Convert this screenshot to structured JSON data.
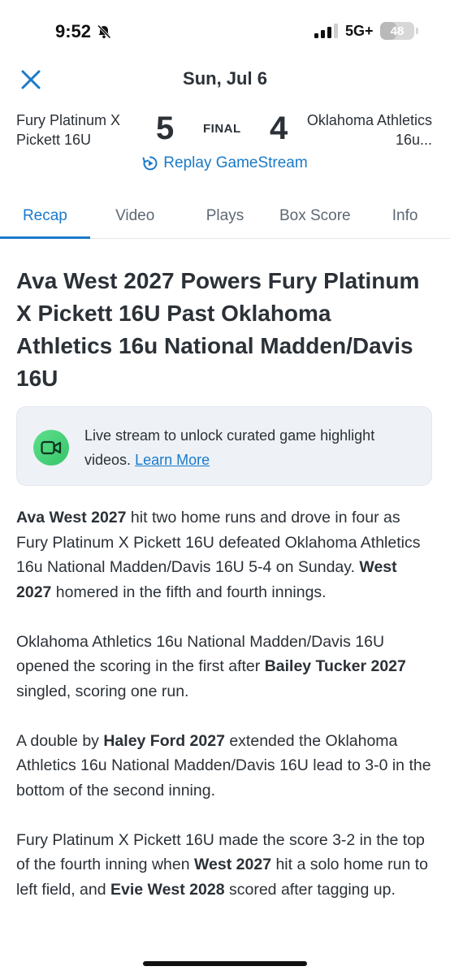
{
  "status_bar": {
    "time": "9:52",
    "network": "5G+",
    "battery": "48",
    "battery_level_percent": 48
  },
  "header": {
    "date": "Sun, Jul 6"
  },
  "game": {
    "home_team": "Fury Platinum X Pickett 16U",
    "away_team": "Oklahoma Athletics 16u...",
    "home_score": "5",
    "away_score": "4",
    "status": "FINAL",
    "replay_label": "Replay GameStream"
  },
  "tabs": [
    {
      "label": "Recap",
      "active": true
    },
    {
      "label": "Video",
      "active": false
    },
    {
      "label": "Plays",
      "active": false
    },
    {
      "label": "Box Score",
      "active": false
    },
    {
      "label": "Info",
      "active": false
    }
  ],
  "article": {
    "headline": "Ava West 2027 Powers Fury Platinum X Pickett 16U Past Oklahoma Athletics 16u National Madden/Davis 16U",
    "promo_text": "Live stream to unlock curated game highlight videos.",
    "promo_link": "Learn More",
    "p1": {
      "b1": "Ava West 2027",
      "t1": " hit two home runs and drove in four as Fury Platinum X Pickett 16U defeated Oklahoma Athletics 16u National Madden/Davis 16U 5-4 on Sunday. ",
      "b2": "West 2027",
      "t2": " homered in the fifth and fourth innings."
    },
    "p2": {
      "t1": "Oklahoma Athletics 16u National Madden/Davis 16U opened the scoring in the first after ",
      "b1": "Bailey Tucker 2027",
      "t2": " singled, scoring one run."
    },
    "p3": {
      "t1": "A double by ",
      "b1": "Haley Ford 2027",
      "t2": " extended the Oklahoma Athletics 16u National Madden/Davis 16U lead to 3-0 in the bottom of the second inning."
    },
    "p4": {
      "t1": "Fury Platinum X Pickett 16U made the score 3-2 in the top of the fourth inning when ",
      "b1": "West 2027",
      "t2": " hit a solo home run to left field, and ",
      "b2": "Evie West 2028",
      "t3": " scored after tagging up."
    }
  },
  "colors": {
    "accent": "#1a7ac8",
    "text": "#2b3137",
    "card_bg": "#eef2f7",
    "video_icon": "#36c46a"
  },
  "icons": {
    "close": "close-icon",
    "bell": "bell-off-icon",
    "signal": "signal-icon",
    "replay": "replay-icon",
    "video": "video-camera-icon"
  }
}
